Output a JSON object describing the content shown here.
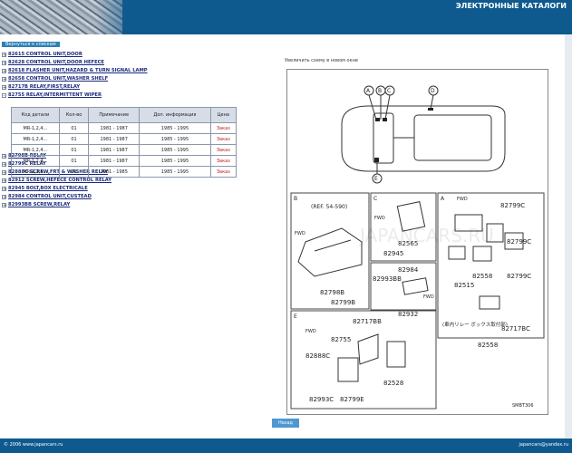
{
  "header": {
    "title": "ЭЛЕКТРОННЫЕ КАТАЛОГИ"
  },
  "breadcrumb": "Вернуться к спискам",
  "tree": [
    {
      "toggle": "+",
      "label": "82615 CONTROL UNIT,DOOR"
    },
    {
      "toggle": "+",
      "label": "82628 CONTROL UNIT,DOOR HEFECE"
    },
    {
      "toggle": "+",
      "label": "82618 FLASHER UNIT,HAZARD & TURN SIGNAL LAMP"
    },
    {
      "toggle": "+",
      "label": "82658 CONTROL UNIT,WASHER SHELF"
    },
    {
      "toggle": "+",
      "label": "82717B RELAY,FIRST,RELAY"
    },
    {
      "toggle": "-",
      "label": "82755 RELAY,INTERMITTENT WIPER"
    },
    {
      "toggle": "+",
      "label": "82798B RELAY"
    },
    {
      "toggle": "+",
      "label": "82799C RELAY"
    },
    {
      "toggle": "+",
      "label": "82888C SCREW,FRT & WASHER RELAY"
    },
    {
      "toggle": "+",
      "label": "82912 SCREW,HEFECE CONTROL RELAY"
    },
    {
      "toggle": "+",
      "label": "82945 BOLT,BOX ELECTRICALE"
    },
    {
      "toggle": "+",
      "label": "82984 CONTROL UNIT,CUSTEAD"
    },
    {
      "toggle": "+",
      "label": "82993BB SCREW,RELAY"
    }
  ],
  "table": {
    "headers": [
      "Код детали",
      "Кол-во",
      "Примечание",
      "Доп. информация",
      "Цена"
    ],
    "rows": [
      [
        "MR-1,2,4...",
        "01",
        "1981 - 1987",
        "1985 - 1995",
        "Заказ"
      ],
      [
        "MR-1,2,4...",
        "01",
        "1981 - 1987",
        "1985 - 1995",
        "Заказ"
      ],
      [
        "MR-1,2,4...",
        "01",
        "1981 - 1987",
        "1985 - 1995",
        "Заказ"
      ],
      [
        "MR-1,2,4...",
        "01",
        "1981 - 1987",
        "1985 - 1995",
        "Заказ"
      ],
      [
        "MR-1,2,4...",
        "01",
        "1981 - 1985",
        "1985 - 1995",
        "Заказ"
      ]
    ]
  },
  "diagram": {
    "caption": "Увеличить схему в новом окне",
    "watermark": "JAPANCARS.RU",
    "section_labels": [
      "A",
      "B",
      "C",
      "D",
      "E"
    ],
    "ref": "(REF. 54-590)",
    "fwd": "FWD",
    "code": "SMBT306",
    "japanese_note": "(車内リレー ボックス取付部)",
    "part_numbers": {
      "b": [
        "82798B",
        "82799B"
      ],
      "c": [
        "82565",
        "82945"
      ],
      "a": [
        "82799C",
        "82799C",
        "82558",
        "82515",
        "82799C",
        "82717BC",
        "82558"
      ],
      "mid": [
        "82984",
        "82993BB"
      ],
      "e": [
        "82932",
        "82717BB",
        "82755",
        "82888C",
        "82528",
        "82993C",
        "82799E"
      ]
    }
  },
  "footer": {
    "button_label": "Назад",
    "left_text": "© 2006 www.japancars.ru",
    "right_text": "japancars@yandex.ru"
  }
}
